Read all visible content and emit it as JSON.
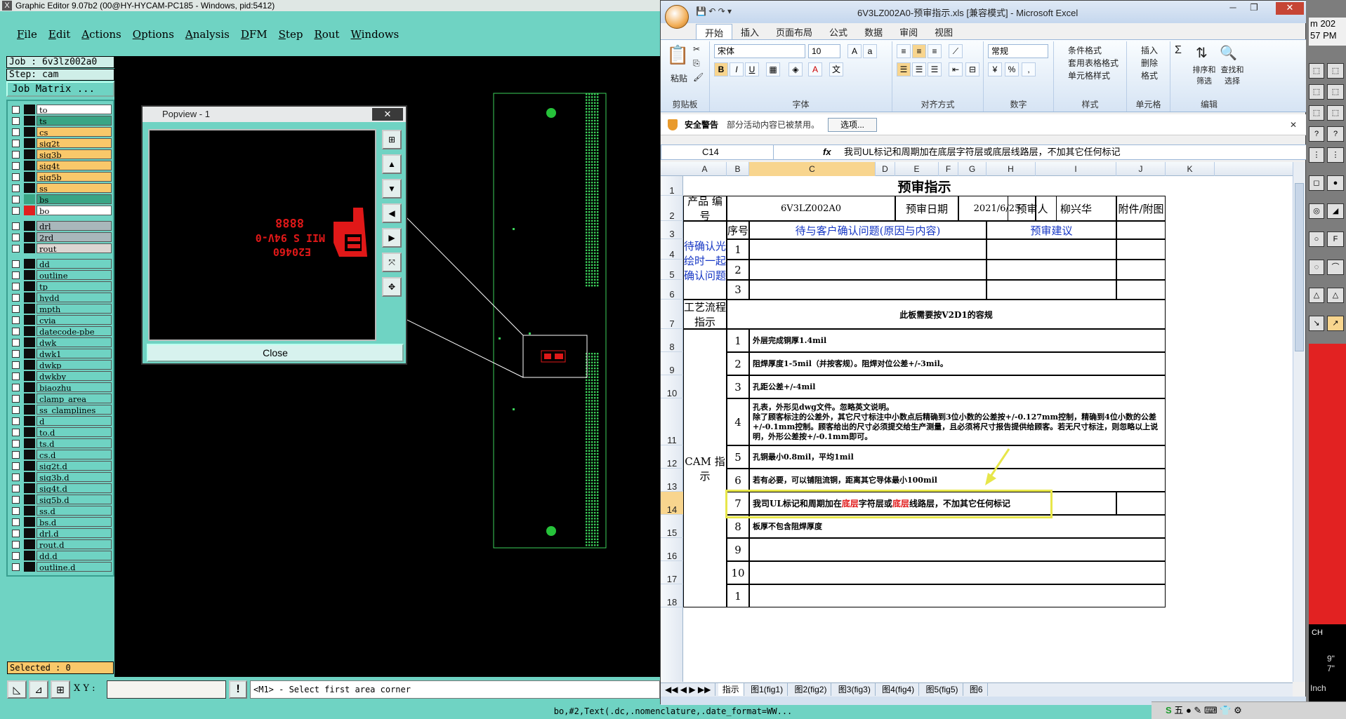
{
  "graphic_editor": {
    "title": "Graphic Editor 9.07b2 (00@HY-HYCAM-PC185 - Windows, pid:5412)",
    "menu": [
      "File",
      "Edit",
      "Actions",
      "Options",
      "Analysis",
      "DFM",
      "Step",
      "Rout",
      "Windows"
    ],
    "job_label": "Job : 6v3lz002a0",
    "step_label": "Step: cam",
    "job_matrix_button": "Job Matrix ...",
    "layers_group1": [
      {
        "name": "to",
        "color": "#ffffff",
        "swatch": "#0d0d0d"
      },
      {
        "name": "ts",
        "color": "#3aa585",
        "swatch": "#0d0d0d"
      },
      {
        "name": "cs",
        "color": "#f9c86a",
        "swatch": "#0d0d0d"
      },
      {
        "name": "sig2t",
        "color": "#f9c86a",
        "swatch": "#0d0d0d"
      },
      {
        "name": "sig3b",
        "color": "#f9c86a",
        "swatch": "#0d0d0d"
      },
      {
        "name": "sig4t",
        "color": "#f9c86a",
        "swatch": "#0d0d0d"
      },
      {
        "name": "sig5b",
        "color": "#f9c86a",
        "swatch": "#0d0d0d"
      },
      {
        "name": "ss",
        "color": "#f9c86a",
        "swatch": "#0d0d0d"
      },
      {
        "name": "bs",
        "color": "#3aa585",
        "swatch": "#3aa585"
      },
      {
        "name": "bo",
        "color": "#ffffff",
        "swatch": "#e02020"
      }
    ],
    "layers_group2": [
      {
        "name": "drl",
        "color": "#a9b7bb",
        "swatch": "#0d0d0d"
      },
      {
        "name": "2rd",
        "color": "#a9b7bb",
        "swatch": "#0d0d0d"
      },
      {
        "name": "rout",
        "color": "#dcd6d2",
        "swatch": "#0d0d0d"
      }
    ],
    "layers_group3": [
      {
        "name": "dd",
        "color": "#6fd3c3",
        "swatch": "#0d0d0d"
      },
      {
        "name": "outline",
        "color": "#6fd3c3",
        "swatch": "#0d0d0d"
      },
      {
        "name": "tp",
        "color": "#6fd3c3",
        "swatch": "#0d0d0d"
      },
      {
        "name": "hydd",
        "color": "#6fd3c3",
        "swatch": "#0d0d0d"
      },
      {
        "name": "mpth",
        "color": "#6fd3c3",
        "swatch": "#0d0d0d"
      },
      {
        "name": "cvia",
        "color": "#6fd3c3",
        "swatch": "#0d0d0d"
      },
      {
        "name": "datecode-pbe",
        "color": "#6fd3c3",
        "swatch": "#0d0d0d"
      },
      {
        "name": "dwk",
        "color": "#6fd3c3",
        "swatch": "#0d0d0d"
      },
      {
        "name": "dwk1",
        "color": "#6fd3c3",
        "swatch": "#0d0d0d"
      },
      {
        "name": "dwkp",
        "color": "#6fd3c3",
        "swatch": "#0d0d0d"
      },
      {
        "name": "dwkby",
        "color": "#6fd3c3",
        "swatch": "#0d0d0d"
      },
      {
        "name": "biaozhu",
        "color": "#6fd3c3",
        "swatch": "#0d0d0d"
      },
      {
        "name": "clamp_area",
        "color": "#6fd3c3",
        "swatch": "#0d0d0d"
      },
      {
        "name": "ss_clamplines",
        "color": "#6fd3c3",
        "swatch": "#0d0d0d"
      },
      {
        "name": "d",
        "color": "#6fd3c3",
        "swatch": "#0d0d0d"
      },
      {
        "name": "to.d",
        "color": "#6fd3c3",
        "swatch": "#0d0d0d"
      },
      {
        "name": "ts.d",
        "color": "#6fd3c3",
        "swatch": "#0d0d0d"
      },
      {
        "name": "cs.d",
        "color": "#6fd3c3",
        "swatch": "#0d0d0d"
      },
      {
        "name": "sig2t.d",
        "color": "#6fd3c3",
        "swatch": "#0d0d0d"
      },
      {
        "name": "sig3b.d",
        "color": "#6fd3c3",
        "swatch": "#0d0d0d"
      },
      {
        "name": "sig4t.d",
        "color": "#6fd3c3",
        "swatch": "#0d0d0d"
      },
      {
        "name": "sig5b.d",
        "color": "#6fd3c3",
        "swatch": "#0d0d0d"
      },
      {
        "name": "ss.d",
        "color": "#6fd3c3",
        "swatch": "#0d0d0d"
      },
      {
        "name": "bs.d",
        "color": "#6fd3c3",
        "swatch": "#0d0d0d"
      },
      {
        "name": "drl.d",
        "color": "#6fd3c3",
        "swatch": "#0d0d0d"
      },
      {
        "name": "rout.d",
        "color": "#6fd3c3",
        "swatch": "#0d0d0d"
      },
      {
        "name": "dd.d",
        "color": "#6fd3c3",
        "swatch": "#0d0d0d"
      },
      {
        "name": "outline.d",
        "color": "#6fd3c3",
        "swatch": "#0d0d0d"
      }
    ],
    "selected_label": "Selected : 0",
    "xy_label": "X Y :",
    "xy_value": "",
    "status_message": "<M1> - Select first area corner",
    "bottom_text": "bo,#2,Text(.dc,.nomenclature,.date_format=WW...",
    "popview": {
      "title": "Popview - 1",
      "close_label": "Close",
      "marking_line1": "E20460",
      "marking_line2": "MII S 94V-0",
      "marking_line3": "8888"
    }
  },
  "excel": {
    "title": "6V3LZ002A0-预审指示.xls  [兼容模式] - Microsoft Excel",
    "tabs": [
      "开始",
      "插入",
      "页面布局",
      "公式",
      "数据",
      "审阅",
      "视图"
    ],
    "active_tab": "开始",
    "ribbon": {
      "paste_label": "粘贴",
      "clipboard_group": "剪贴板",
      "font_name": "宋体",
      "font_size": "10",
      "font_group": "字体",
      "align_group": "对齐方式",
      "number_format": "常规",
      "number_group": "数字",
      "styles_items": [
        "条件格式",
        "套用表格格式",
        "单元格样式"
      ],
      "styles_group": "样式",
      "cells_items": [
        "插入",
        "删除",
        "格式"
      ],
      "cells_group": "单元格",
      "edit_items": [
        "排序和筛选",
        "查找和选择"
      ],
      "edit_group": "编辑"
    },
    "security": {
      "title": "安全警告",
      "message": "部分活动内容已被禁用。",
      "button": "选项..."
    },
    "name_box": "C14",
    "fx": "fx",
    "formula": "我司UL标记和周期加在底层字符层或底层线路层，不加其它任何标记",
    "columns": [
      "A",
      "B",
      "C",
      "D",
      "E",
      "F",
      "G",
      "H",
      "I",
      "J",
      "K"
    ],
    "rows": [
      "1",
      "2",
      "3",
      "4",
      "5",
      "6",
      "7",
      "8",
      "9",
      "10",
      "11",
      "12",
      "13",
      "14",
      "15",
      "16",
      "17",
      "18"
    ],
    "sheet": {
      "title": "预审指示",
      "product_label": "产品\n编号",
      "product_no": "6V3LZ002A0",
      "date_label": "预审日期",
      "date": "2021/6/25",
      "reviewer_label": "预审人",
      "reviewer": "柳兴华",
      "attach_label": "附件/附图",
      "seq_label": "序号",
      "issue_header": "待与客户确认问题(原因与内容)",
      "suggest_header": "预审建议",
      "confirm_label": "待确认光绘时一起确认问题",
      "confirm_nums": [
        "1",
        "2",
        "3"
      ],
      "process_label": "工艺流程指示",
      "process_text": "此板需要按V2D1的容规",
      "cam_label": "CAM\n指示",
      "cam_items": [
        {
          "no": "1",
          "text": "外层完成铜厚1.4mil"
        },
        {
          "no": "2",
          "text": "阻焊厚度1-5mil（并按客规）。阻焊对位公差+/-3mil。"
        },
        {
          "no": "3",
          "text": "孔距公差+/-4mil"
        },
        {
          "no": "4",
          "text": "孔表，外形见dwg文件。忽略英文说明。\n除了顾客标注的公差外，其它尺寸标注中小数点后精确到3位小数的公差按+/-0.127mm控制，精确到4位小数的公差+/-0.1mm控制。顾客给出的尺寸必须提交给生产测量，且必须将尺寸报告提供给顾客。若无尺寸标注，则忽略以上说明，外形公差按+/-0.1mm即可。"
        },
        {
          "no": "5",
          "text": "孔铜最小0.8mil，平均1mil"
        },
        {
          "no": "6",
          "text": "若有必要，可以铺阻流铜，距离其它导体最小100mil"
        },
        {
          "no": "7",
          "text_parts": [
            "我司UL标记和周期加在",
            "底层",
            "字符层或",
            "底层",
            "线路层，不加其它任何标记"
          ]
        },
        {
          "no": "8",
          "text": "板厚不包含阻焊厚度"
        },
        {
          "no": "9",
          "text": ""
        },
        {
          "no": "10",
          "text": ""
        },
        {
          "no": "1",
          "text": ""
        }
      ]
    },
    "sheet_tabs": [
      "指示",
      "图1(fig1)",
      "图2(fig2)",
      "图3(fig3)",
      "图4(fig4)",
      "图5(fig5)",
      "图6"
    ],
    "active_sheet_tab": "指示"
  },
  "right_strip": {
    "clock_line1": "m 202",
    "clock_line2": "57 PM",
    "unit": "Inch",
    "vals": [
      "9\"",
      "7\""
    ],
    "lang": "CH"
  },
  "taskbar": {
    "ime_text": "五"
  },
  "colors": {
    "app_bg": "#6fd3c3",
    "canvas_bg": "#000000",
    "highlight": "#e7e64a",
    "red_text": "#e01818",
    "blue_text": "#1536c4"
  }
}
